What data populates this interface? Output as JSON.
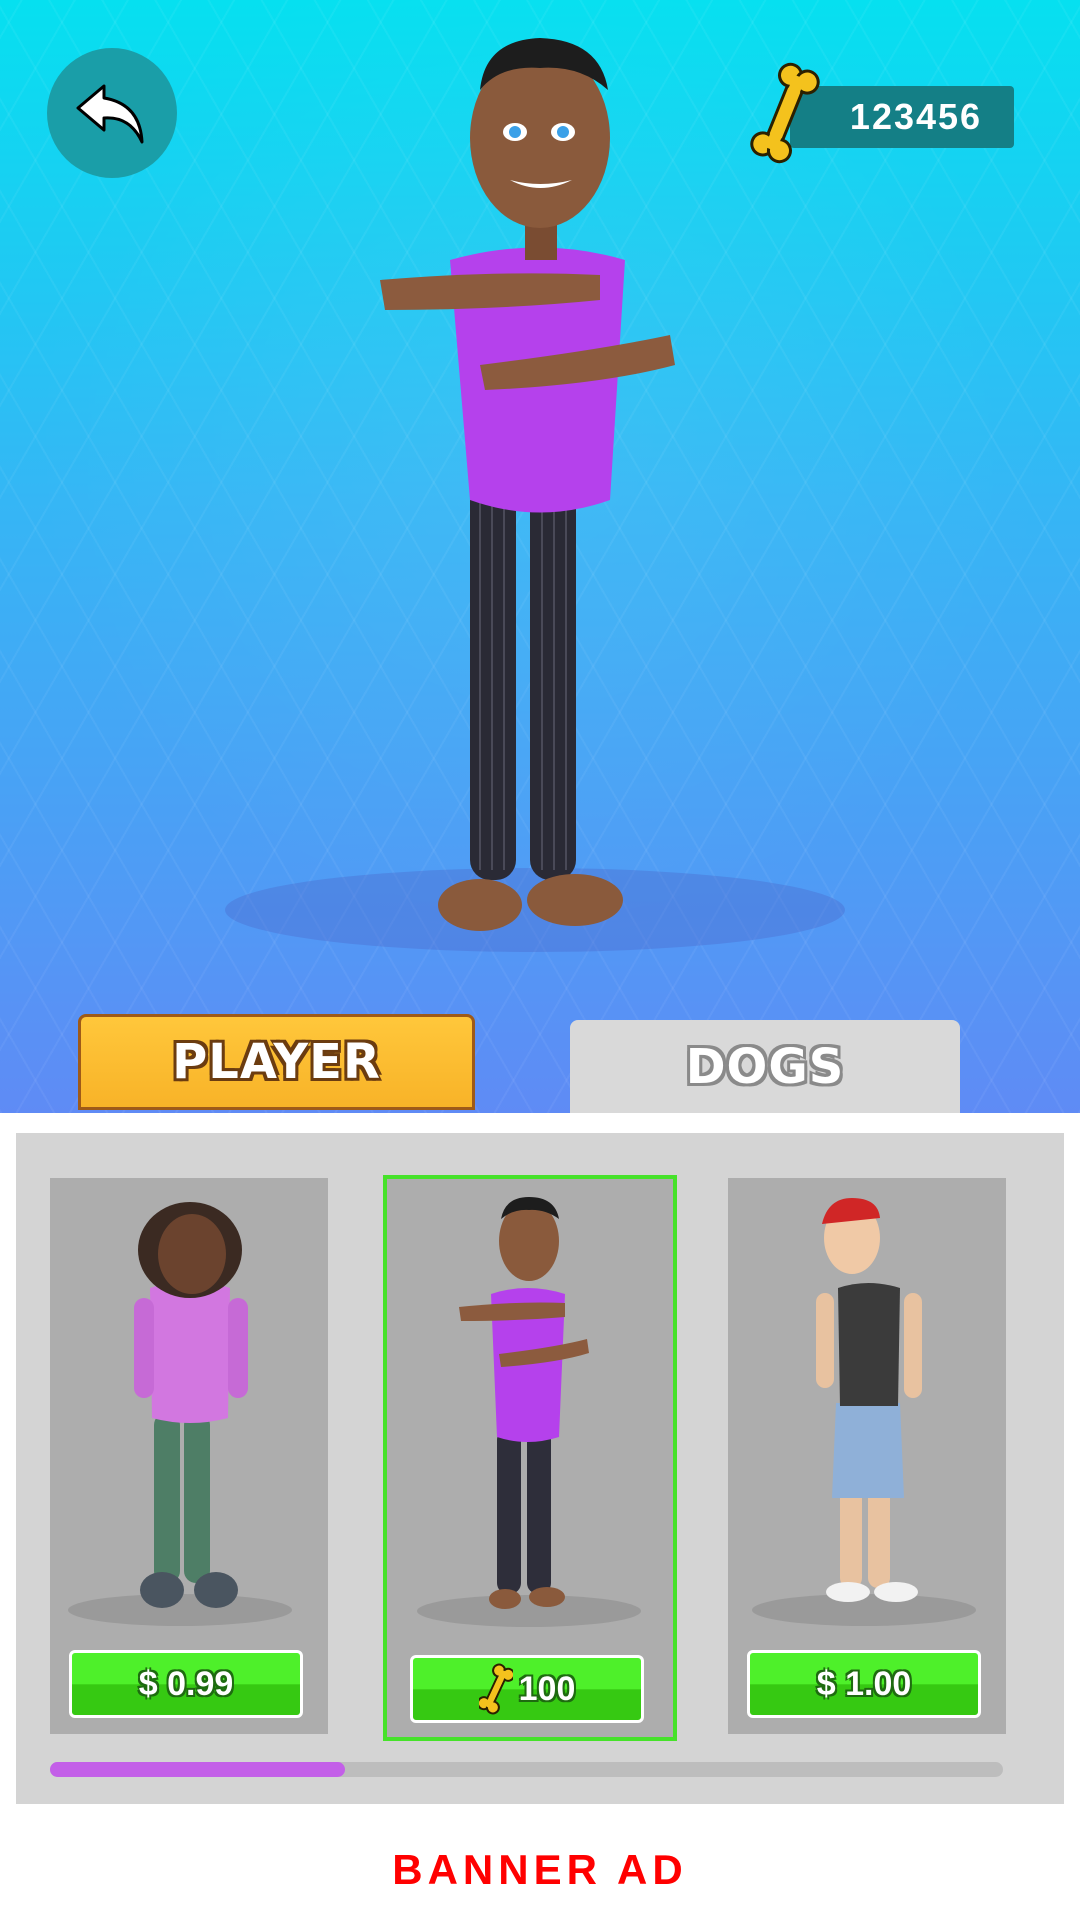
{
  "header": {
    "back_icon": "undo-arrow-icon",
    "currency_icon": "bone-icon",
    "currency_value": "123456"
  },
  "tabs": [
    {
      "label": "PLAYER",
      "selected": true
    },
    {
      "label": "DOGS",
      "selected": false
    }
  ],
  "characters": [
    {
      "price": "$ 0.99",
      "currency_icon": null,
      "selected": false,
      "description": "girl-pink-hoodie"
    },
    {
      "price": "100",
      "currency_icon": "bone-icon",
      "selected": true,
      "description": "boy-purple-shirt"
    },
    {
      "price": "$ 1.00",
      "currency_icon": null,
      "selected": false,
      "description": "boy-red-cap-tank-top"
    }
  ],
  "scroll": {
    "progress": 0.31
  },
  "banner": {
    "label": "BANNER AD"
  },
  "colors": {
    "tab_active": "#f8b328",
    "tab_inactive": "#d9d9d9",
    "buy_button": "#3fd81a",
    "selection_border": "#46e22a",
    "scroll_thumb": "#c35fe8",
    "banner_text": "#ff0000"
  }
}
